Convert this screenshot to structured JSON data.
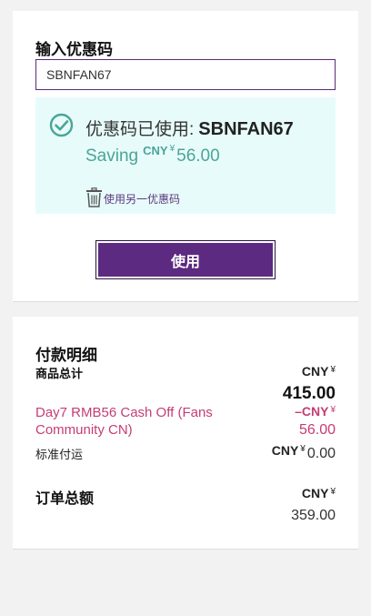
{
  "coupon": {
    "title": "输入优惠码",
    "input_value": "SBNFAN67",
    "applied_label": "优惠码已使用:",
    "applied_code": "SBNFAN67",
    "saving_label": "Saving",
    "saving_currency": "CNY",
    "saving_symbol": "¥",
    "saving_amount": "56.00",
    "remove_label": "使用另一优惠码",
    "apply_button": "使用",
    "accent_color": "#5c2a80",
    "success_color": "#4aa596"
  },
  "payment": {
    "title": "付款明细",
    "subtotal": {
      "label": "商品总计",
      "currency": "CNY",
      "symbol": "¥",
      "amount": "415.00"
    },
    "discount": {
      "label": "Day7 RMB56 Cash Off (Fans Community CN)",
      "minus": "–",
      "currency": "CNY",
      "symbol": "¥",
      "amount": "56.00",
      "color": "#c43d74"
    },
    "shipping": {
      "label": "标准付运",
      "currency": "CNY",
      "symbol": "¥",
      "amount": "0.00"
    },
    "total": {
      "label": "订单总额",
      "currency": "CNY",
      "symbol": "¥",
      "amount": "359.00"
    }
  }
}
